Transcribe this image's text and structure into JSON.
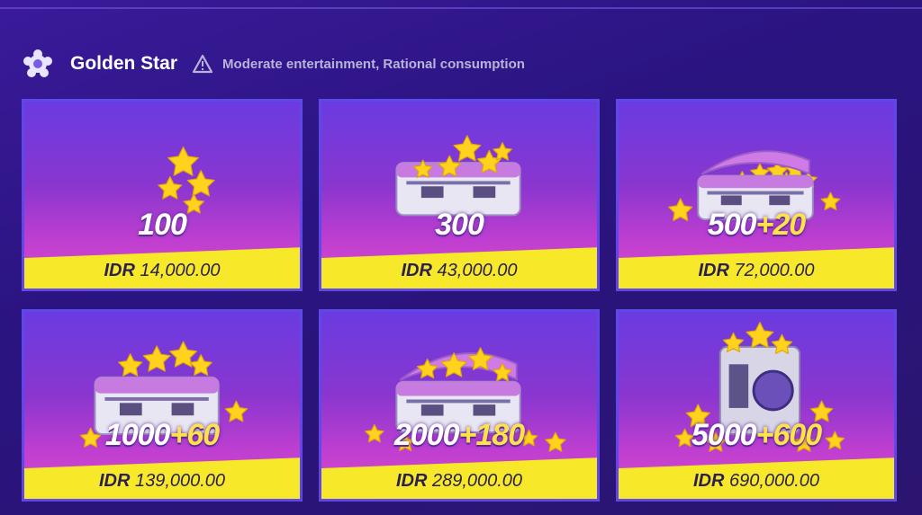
{
  "header": {
    "title": "Golden Star",
    "notice": "Moderate entertainment, Rational consumption"
  },
  "colors": {
    "accent_yellow": "#f7e92a",
    "card_border": "#5e49e8",
    "bonus_text": "#ffe14a"
  },
  "packages": [
    {
      "amount": "100",
      "bonus": "",
      "currency": "IDR",
      "price": "14,000.00",
      "icon": "star-cluster-small"
    },
    {
      "amount": "300",
      "bonus": "",
      "currency": "IDR",
      "price": "43,000.00",
      "icon": "star-box"
    },
    {
      "amount": "500",
      "bonus": "+20",
      "currency": "IDR",
      "price": "72,000.00",
      "icon": "star-open-box"
    },
    {
      "amount": "1000",
      "bonus": "+60",
      "currency": "IDR",
      "price": "139,000.00",
      "icon": "star-large-box"
    },
    {
      "amount": "2000",
      "bonus": "+180",
      "currency": "IDR",
      "price": "289,000.00",
      "icon": "star-open-chest"
    },
    {
      "amount": "5000",
      "bonus": "+600",
      "currency": "IDR",
      "price": "690,000.00",
      "icon": "star-safe"
    }
  ]
}
